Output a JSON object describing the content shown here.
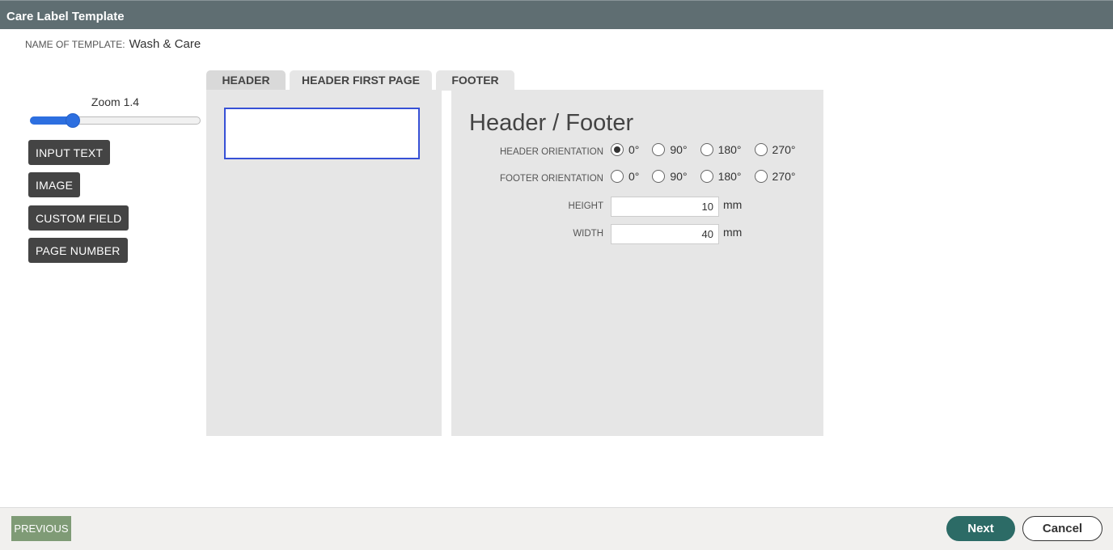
{
  "window": {
    "title": "Care Label Template"
  },
  "template": {
    "name_label": "NAME OF TEMPLATE:",
    "name_value": "Wash & Care"
  },
  "zoom": {
    "label": "Zoom 1.4",
    "value": 1.4,
    "fraction": 0.25
  },
  "tools": {
    "input_text": "INPUT TEXT",
    "image": "IMAGE",
    "custom_field": "CUSTOM FIELD",
    "page_number": "PAGE NUMBER"
  },
  "tabs": [
    {
      "label": "HEADER",
      "active": true
    },
    {
      "label": "HEADER FIRST PAGE",
      "active": false
    },
    {
      "label": "FOOTER",
      "active": false
    }
  ],
  "props": {
    "title": "Header / Footer",
    "header_orientation": {
      "label": "HEADER ORIENTATION",
      "options": [
        "0°",
        "90°",
        "180°",
        "270°"
      ],
      "selected": "0°"
    },
    "footer_orientation": {
      "label": "FOOTER ORIENTATION",
      "options": [
        "0°",
        "90°",
        "180°",
        "270°"
      ],
      "selected": ""
    },
    "height": {
      "label": "HEIGHT",
      "value": "10",
      "unit": "mm"
    },
    "width": {
      "label": "WIDTH",
      "value": "40",
      "unit": "mm"
    }
  },
  "footer": {
    "previous": "PREVIOUS",
    "next": "Next",
    "cancel": "Cancel"
  },
  "colors": {
    "titlebar": "#5f6e72",
    "accent_blue": "#2d6fe0",
    "next_button": "#2c6b66",
    "previous_button": "#7f9b76"
  }
}
